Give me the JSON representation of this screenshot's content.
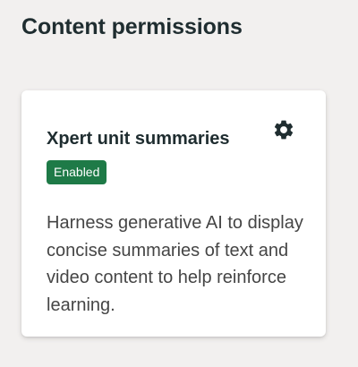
{
  "page": {
    "title": "Content permissions"
  },
  "card": {
    "title": "Xpert unit summaries",
    "status": "Enabled",
    "description": "Harness generative AI to display concise summaries of text and video content to help reinforce learning.",
    "settings_icon": "gear-icon"
  },
  "colors": {
    "background": "#f2f0ef",
    "text_primary": "#1f2d30",
    "text_body": "#454545",
    "badge_bg": "#1e7a47",
    "badge_text": "#ffffff"
  }
}
